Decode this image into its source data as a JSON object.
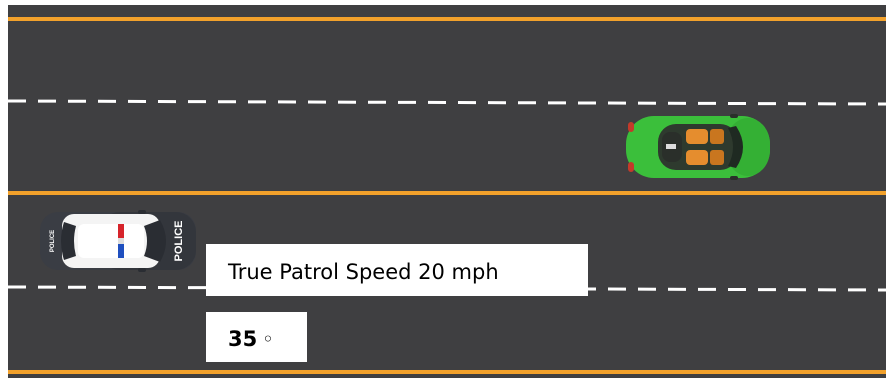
{
  "road": {
    "asphalt_color": "#3f3f41",
    "edge_line_color": "#f2a12b",
    "center_line_color": "#f2a12b",
    "lane_dash_color": "#ffffff"
  },
  "vehicles": {
    "police": {
      "icon": "police-car-icon",
      "roof_text": "POLICE",
      "hood_text": "POLICE",
      "body_color": "#ffffff",
      "hood_color": "#3a3d44",
      "light_red": "#d6242b",
      "light_blue": "#1f4fbf"
    },
    "convertible": {
      "icon": "green-convertible-icon",
      "body_color": "#3bbf3b",
      "seat_color": "#e58d2e"
    }
  },
  "labels": {
    "speed_text": "True Patrol Speed 20 mph",
    "angle_value": "35",
    "angle_unit": "◦"
  }
}
